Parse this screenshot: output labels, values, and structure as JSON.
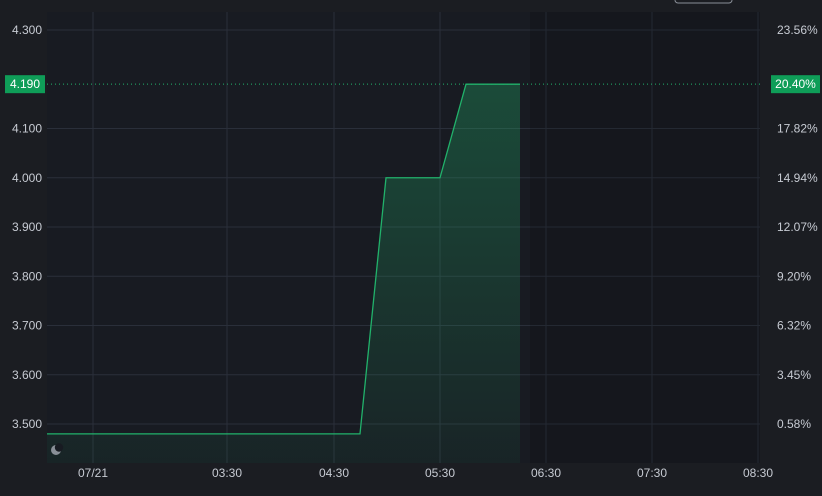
{
  "colors": {
    "background": "#1b1d22",
    "plot_background": "#181b22",
    "grid": "#2a2f3a",
    "axis_text": "#c7cbd3",
    "line": "#21b26b",
    "area_fill": "#1e4a3a",
    "price_badge": "#0f9d58",
    "badge_text": "#ffffff"
  },
  "icons": {
    "logo": "moon-icon"
  },
  "chart_data": {
    "type": "area",
    "title": "",
    "xlabel": "",
    "ylabel": "",
    "grid": true,
    "x_tick_labels": [
      "07/21",
      "03:30",
      "04:30",
      "05:30",
      "06:30",
      "07:30",
      "08:30"
    ],
    "left_axis": {
      "ylim": [
        3.45,
        4.33
      ],
      "ticks": [
        "4.300",
        "4.100",
        "4.000",
        "3.900",
        "3.800",
        "3.700",
        "3.600",
        "3.500"
      ]
    },
    "right_axis": {
      "ticks": [
        "23.56%",
        "17.82%",
        "14.94%",
        "12.07%",
        "9.20%",
        "6.32%",
        "3.45%",
        "0.58%"
      ]
    },
    "current_value": {
      "price_label": "4.190",
      "percent_label": "20.40%",
      "value": 4.19
    },
    "series": [
      {
        "x": [
          "07/21 start",
          "04:38",
          "04:44",
          "05:35",
          "05:50",
          "06:28"
        ],
        "values": [
          3.48,
          3.48,
          4.0,
          4.0,
          4.19,
          4.19
        ]
      }
    ]
  }
}
